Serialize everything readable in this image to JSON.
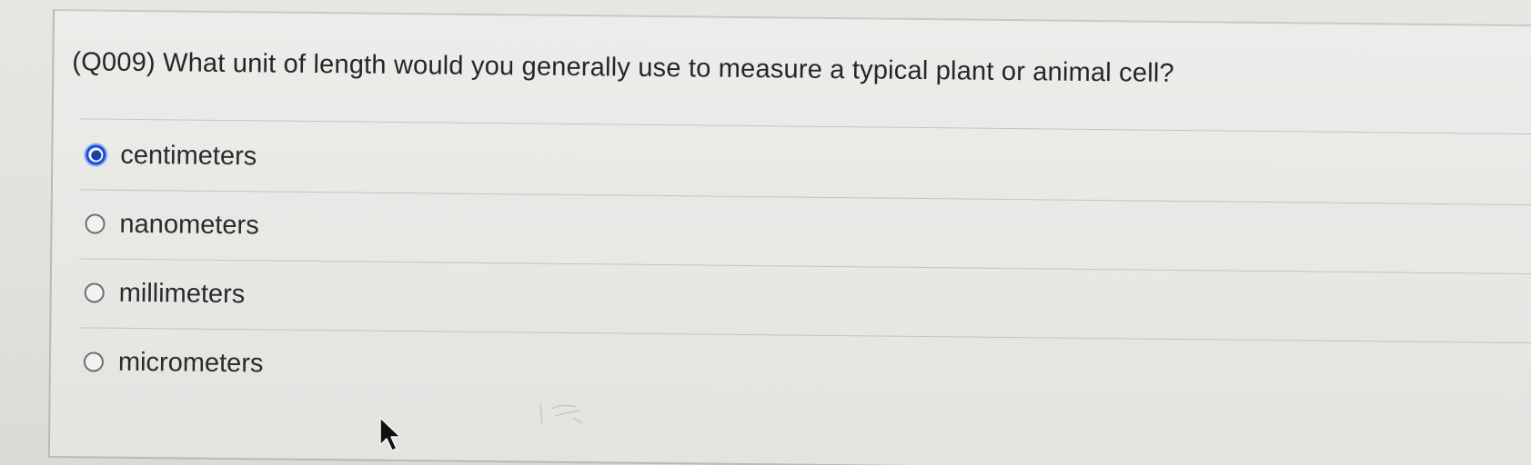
{
  "quiz": {
    "question": "(Q009) What unit of length would you generally use to measure a typical plant or animal cell?",
    "selected_option": "centimeters",
    "options": [
      {
        "label": "centimeters",
        "checked": true
      },
      {
        "label": "nanometers",
        "checked": false
      },
      {
        "label": "millimeters",
        "checked": false
      },
      {
        "label": "micrometers",
        "checked": false
      }
    ]
  },
  "colors": {
    "radio_selected": "#1d4fd8",
    "text": "#262626",
    "background": "#e6e6e2"
  },
  "icons": [
    "radio-selected-icon",
    "radio-unselected-icon",
    "mouse-pointer-icon"
  ]
}
